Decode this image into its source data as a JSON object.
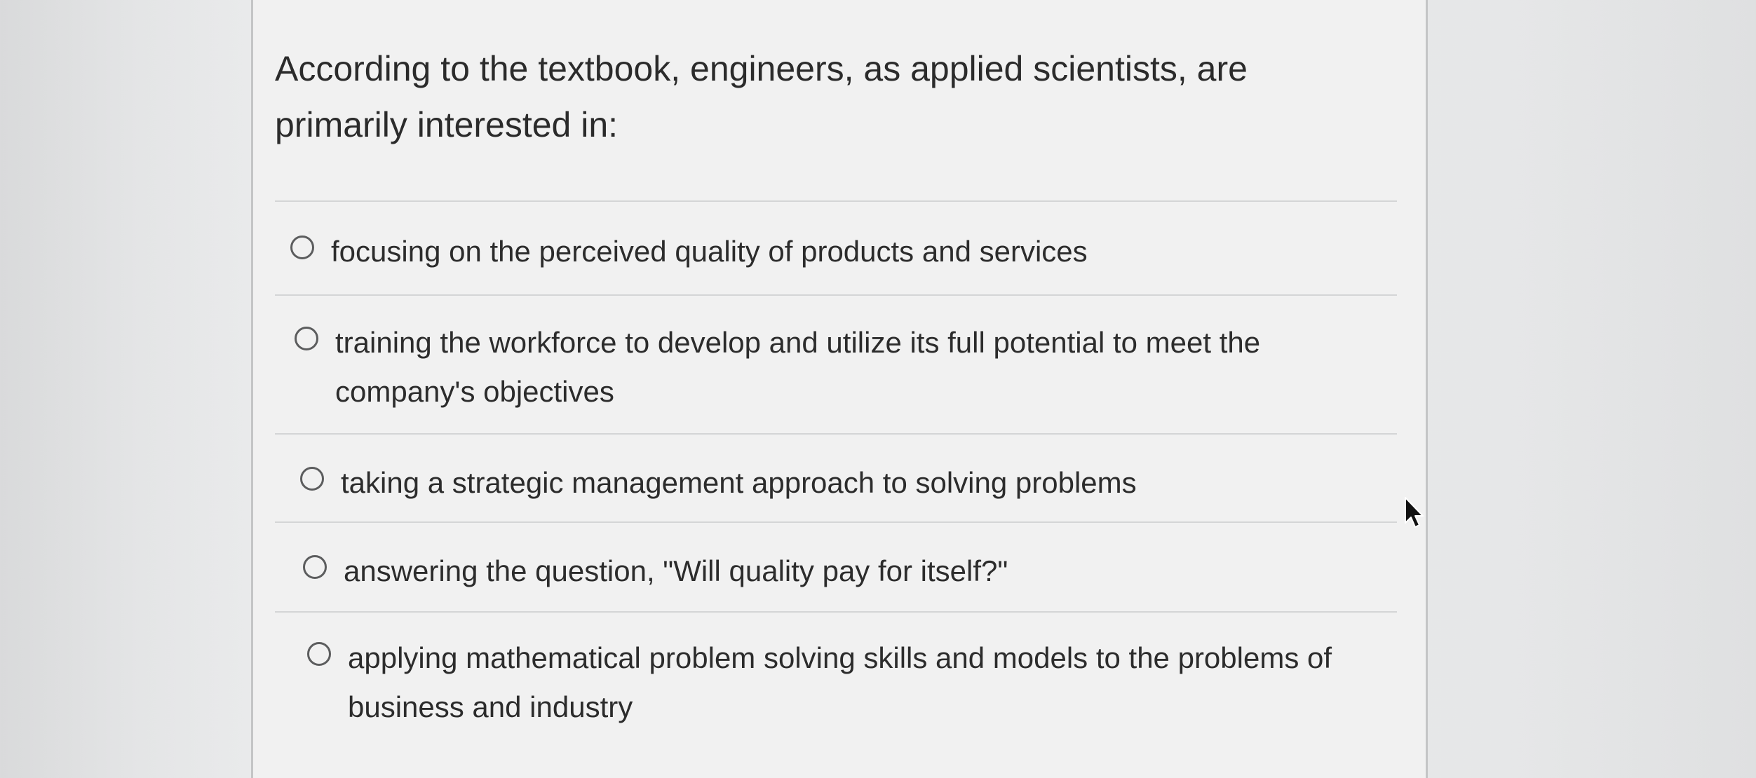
{
  "question": {
    "text": "According to the textbook, engineers, as applied scientists, are primarily interested in:"
  },
  "options": [
    {
      "label": "focusing on the perceived quality of products and services",
      "selected": false
    },
    {
      "label": "training the workforce to develop and utilize its full potential to meet the company's objectives",
      "selected": false
    },
    {
      "label": "taking a strategic management approach to solving problems",
      "selected": false
    },
    {
      "label": "answering the question, \"Will quality pay for itself?\"",
      "selected": false
    },
    {
      "label": "applying mathematical problem solving skills and models to the problems of business and industry",
      "selected": false
    }
  ],
  "icons": {
    "radio": "radio-button-empty",
    "cursor": "mouse-pointer-arrow"
  },
  "colors": {
    "text": "#2c2c2c",
    "radio_border": "#5c5d5e",
    "card_background": "#f1f1f1"
  }
}
